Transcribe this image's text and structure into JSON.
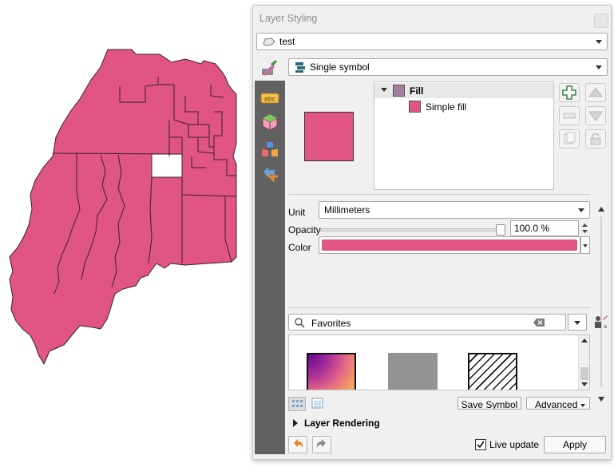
{
  "window": {
    "title": "Layer Styling"
  },
  "layer_select": {
    "value": "test"
  },
  "renderer_select": {
    "value": "Single symbol"
  },
  "symbol_tree": {
    "root": "Fill",
    "child": "Simple fill"
  },
  "colors": {
    "fill": "#e05584",
    "fill_root_swatch": "#a0809f",
    "sidebar": "#616161",
    "map_stroke": "#3a2030"
  },
  "properties": {
    "unit_label": "Unit",
    "unit_value": "Millimeters",
    "opacity_label": "Opacity",
    "opacity_value": "100.0 %",
    "opacity_fraction": 1.0,
    "color_label": "Color"
  },
  "library": {
    "search_placeholder": "Favorites",
    "save_symbol": "Save Symbol",
    "advanced": "Advanced"
  },
  "layer_rendering": {
    "label": "Layer Rendering"
  },
  "footer": {
    "live_update": "Live update",
    "apply": "Apply"
  }
}
